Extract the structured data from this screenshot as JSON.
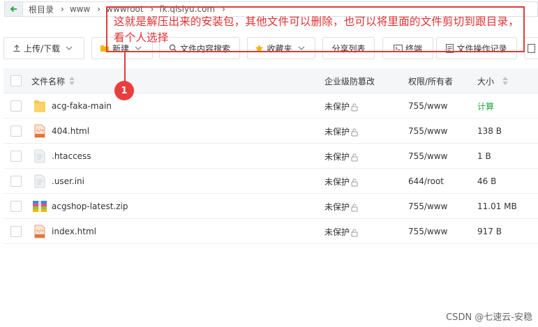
{
  "breadcrumb": {
    "items": [
      "根目录",
      "www",
      "wwwroot",
      "fk.qlslyu.com"
    ]
  },
  "toolbar": {
    "upload": "上传/下载",
    "new": "新建",
    "search": "文件内容搜索",
    "favorites": "收藏夹",
    "share_list": "分享列表",
    "terminal": "终端",
    "op_log": "文件操作记录"
  },
  "table": {
    "headers": {
      "name": "文件名称",
      "tamper": "企业级防篡改",
      "perm": "权限/所有者",
      "size": "大小"
    },
    "rows": [
      {
        "name": "acg-faka-main",
        "icon": "folder-icon",
        "tamper": "未保护",
        "perm": "755/www",
        "size": "计算"
      },
      {
        "name": "404.html",
        "icon": "html-file-icon",
        "tamper": "未保护",
        "perm": "755/www",
        "size": "138 B"
      },
      {
        "name": ".htaccess",
        "icon": "text-file-icon",
        "tamper": "未保护",
        "perm": "755/www",
        "size": "1 B"
      },
      {
        "name": ".user.ini",
        "icon": "text-file-icon",
        "tamper": "未保护",
        "perm": "644/root",
        "size": "46 B"
      },
      {
        "name": "acgshop-latest.zip",
        "icon": "zip-file-icon",
        "tamper": "未保护",
        "perm": "755/www",
        "size": "11.01 MB"
      },
      {
        "name": "index.html",
        "icon": "html-file-icon",
        "tamper": "未保护",
        "perm": "755/www",
        "size": "917 B"
      }
    ]
  },
  "annotation": {
    "text": "这就是解压出来的安装包，其他文件可以删除，也可以将里面的文件剪切到跟目录，看个人选择",
    "badge": "1"
  },
  "watermark": "CSDN @七速云-安稳",
  "colors": {
    "annotation_red": "#e13a3a",
    "compute_green": "#20a53a"
  }
}
